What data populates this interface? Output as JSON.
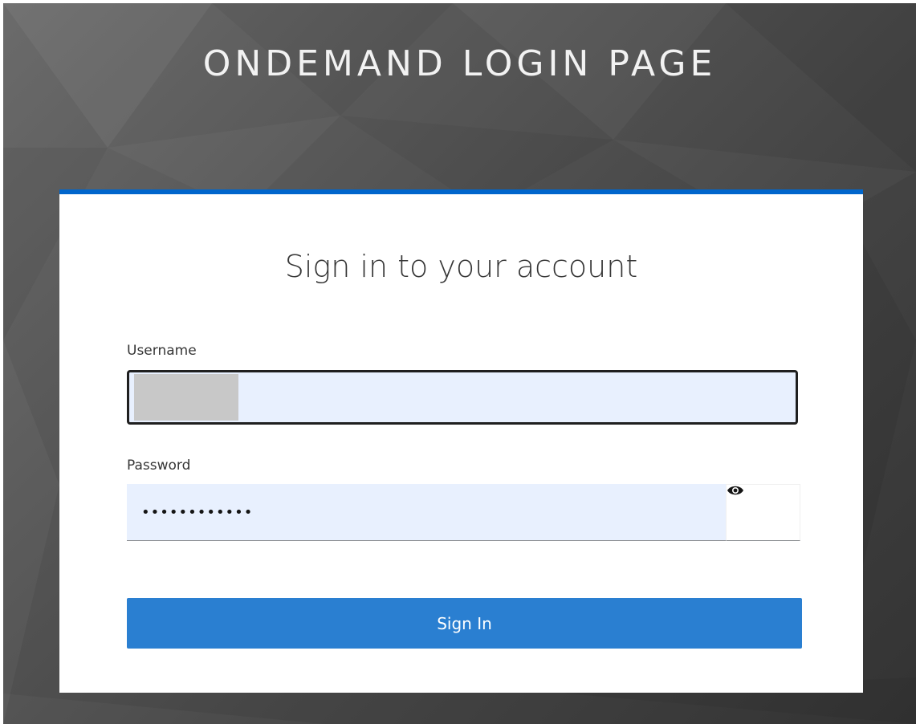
{
  "page": {
    "title": "ONDEMAND LOGIN PAGE"
  },
  "login": {
    "heading": "Sign in to your account",
    "username_label": "Username",
    "password_label": "Password",
    "password_value": "••••••••••••",
    "submit_label": "Sign In"
  },
  "colors": {
    "accent": "#0066cc",
    "button": "#2a7fd1",
    "input_bg": "#e8f0fe"
  },
  "icons": {
    "password_toggle": "eye-icon"
  }
}
